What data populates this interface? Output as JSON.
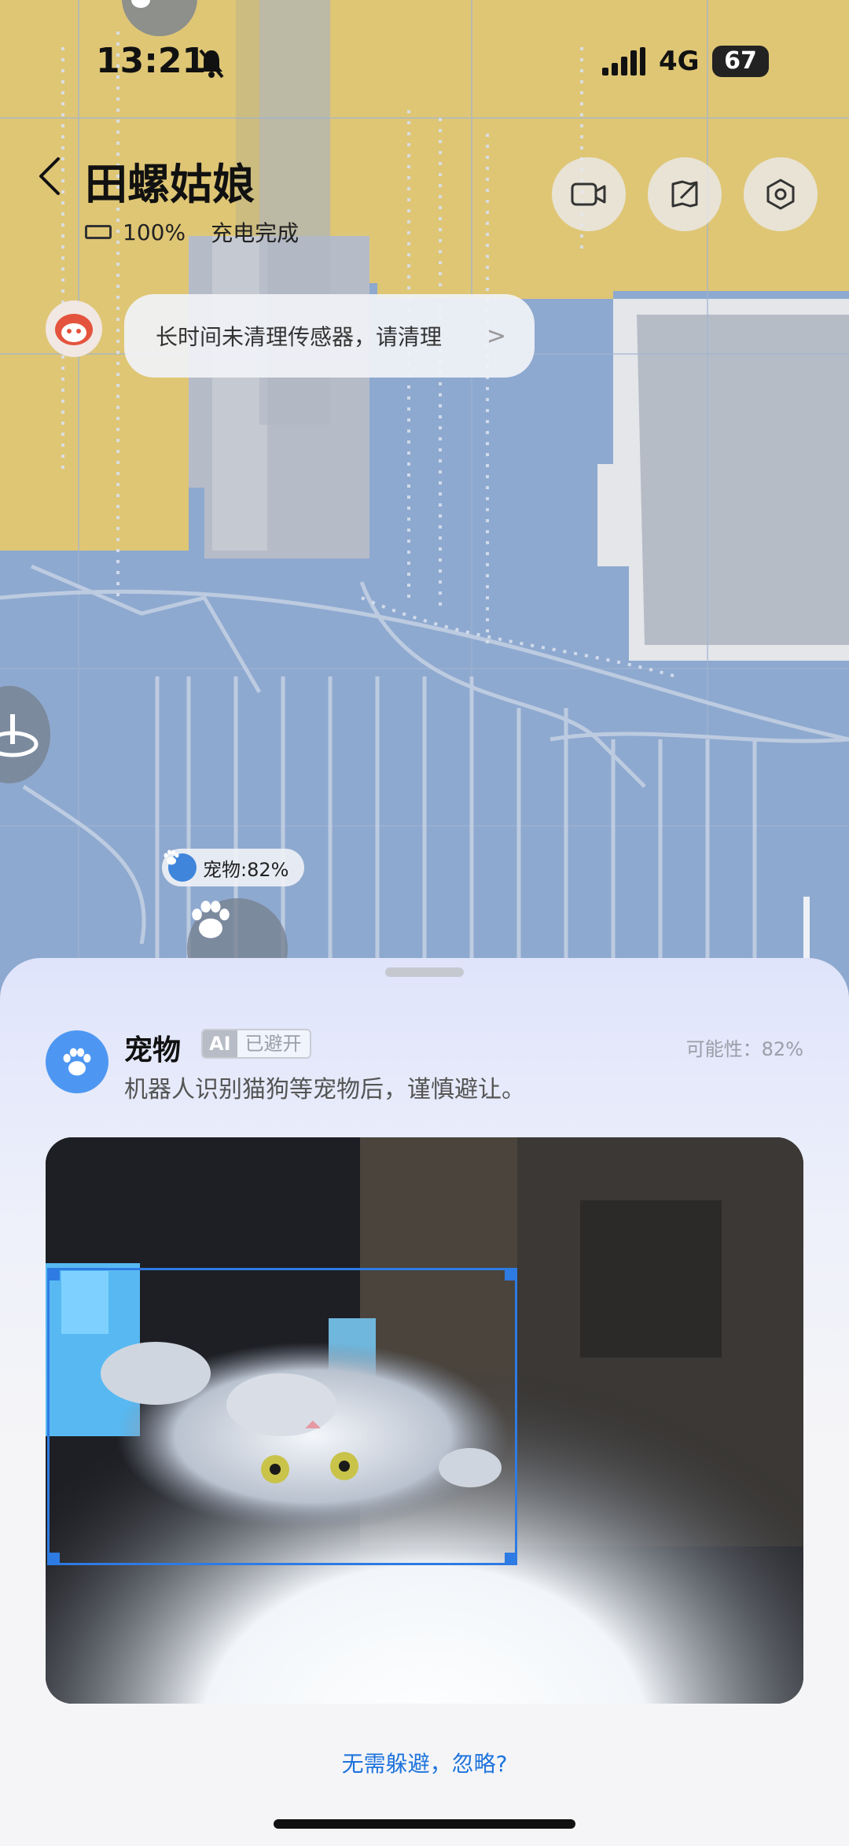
{
  "status_bar": {
    "time": "13:21",
    "network": "4G",
    "battery": "67"
  },
  "header": {
    "title": "田螺姑娘",
    "battery_level": "100%",
    "charge_status": "充电完成"
  },
  "notice": {
    "text": "长时间未清理传感器，请清理",
    "chevron": ">"
  },
  "map": {
    "pet_label": "宠物:82%"
  },
  "sheet": {
    "title": "宠物",
    "ai_tag": "AI",
    "avoided_tag": "已避开",
    "probability": "可能性：82%",
    "description": "机器人识别猫狗等宠物后，谨慎避让。",
    "ignore_link": "无需躲避，忽略?"
  },
  "icons": {
    "back": "chevron-left-icon",
    "video": "video-camera-icon",
    "edit": "edit-map-icon",
    "settings": "settings-icon",
    "paw": "paw-icon"
  },
  "colors": {
    "accent": "#1f74dd",
    "map_blue": "#8ea9cf",
    "map_yellow": "#e8c96a",
    "detection_box": "#2e7be3"
  }
}
